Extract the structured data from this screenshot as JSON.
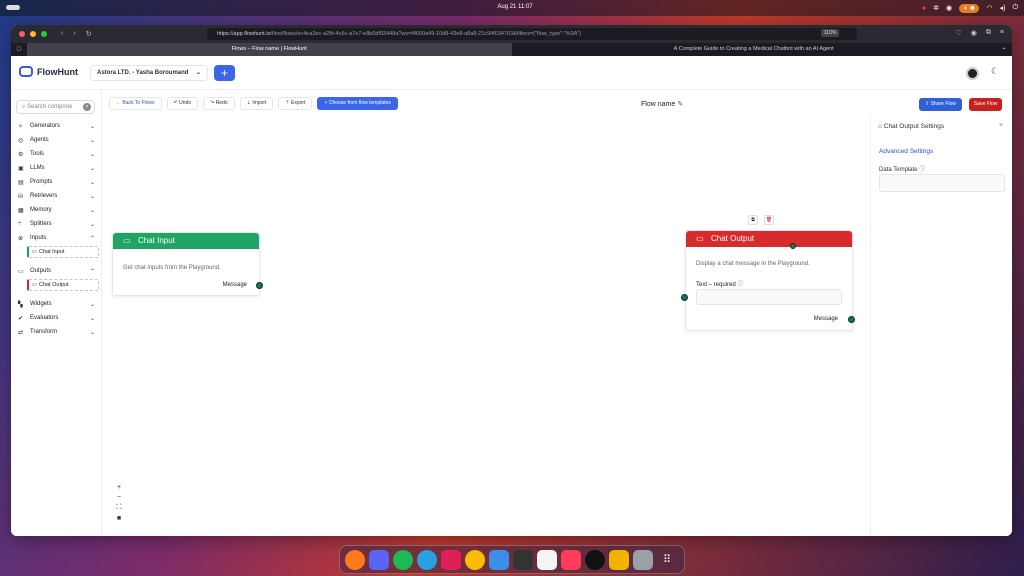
{
  "system": {
    "clock": "Aug 21  11:07"
  },
  "browser": {
    "url_host": "https://app.flowhunt.io",
    "url_rest": "/flow/flows/ec4ea3ec-a2fb-4c6c-a7e7-e8b0df93448a?ws=f4600a49-10d8-43e8-a8a8-21c94f034763&filters={\"flow_type\":\"%3A\"}",
    "zoom": "110%",
    "tabs": [
      {
        "title": "Flows – Flow name | FlowHunt",
        "active": true
      },
      {
        "title": "A Complete Guide to Creating a Medical Chatbot with an AI Agent",
        "active": false
      }
    ]
  },
  "app": {
    "brand": "FlowHunt",
    "org_selector": "Astora LTD. - Yasha Boroumand",
    "add_label": "+",
    "search_placeholder": "Search compone",
    "sidebar": [
      {
        "label": "Generators",
        "icon": "sparkle-icon",
        "glyph": "✧"
      },
      {
        "label": "Agents",
        "icon": "agent-icon",
        "glyph": "◎"
      },
      {
        "label": "Tools",
        "icon": "wrench-icon",
        "glyph": "⚙"
      },
      {
        "label": "LLMs",
        "icon": "chip-icon",
        "glyph": "▣"
      },
      {
        "label": "Prompts",
        "icon": "prompt-icon",
        "glyph": "▤"
      },
      {
        "label": "Retrievers",
        "icon": "database-icon",
        "glyph": "⛁"
      },
      {
        "label": "Memory",
        "icon": "memory-icon",
        "glyph": "▦"
      },
      {
        "label": "Splitters",
        "icon": "split-icon",
        "glyph": "⑂"
      }
    ],
    "sidebar_inputs": {
      "label": "Inputs",
      "child": "Chat Input"
    },
    "sidebar_outputs": {
      "label": "Outputs",
      "child": "Chat Output"
    },
    "sidebar_bottom": [
      {
        "label": "Widgets",
        "icon": "widget-icon",
        "glyph": "▚"
      },
      {
        "label": "Evaluators",
        "icon": "evaluator-icon",
        "glyph": "✔"
      },
      {
        "label": "Transform",
        "icon": "transform-icon",
        "glyph": "⇄"
      }
    ],
    "toolbar": {
      "back": "Back To Flows",
      "undo": "Undo",
      "redo": "Redo",
      "import": "Import",
      "export": "Export",
      "templates": "Choose from flow templates"
    },
    "flow_name": "Flow name",
    "share": "Share Flow",
    "save": "Save Flow"
  },
  "nodes": {
    "chat_input": {
      "title": "Chat Input",
      "description": "Get chat inputs from the Playground.",
      "output_label": "Message",
      "color": "#1fa463"
    },
    "chat_output": {
      "title": "Chat Output",
      "description": "Display a chat message in the Playground.",
      "field_label": "Text – required",
      "output_label": "Message",
      "color": "#d92b2b"
    }
  },
  "right_panel": {
    "title": "Chat Output Settings",
    "section": "Advanced Settings",
    "field_label": "Data Template"
  }
}
